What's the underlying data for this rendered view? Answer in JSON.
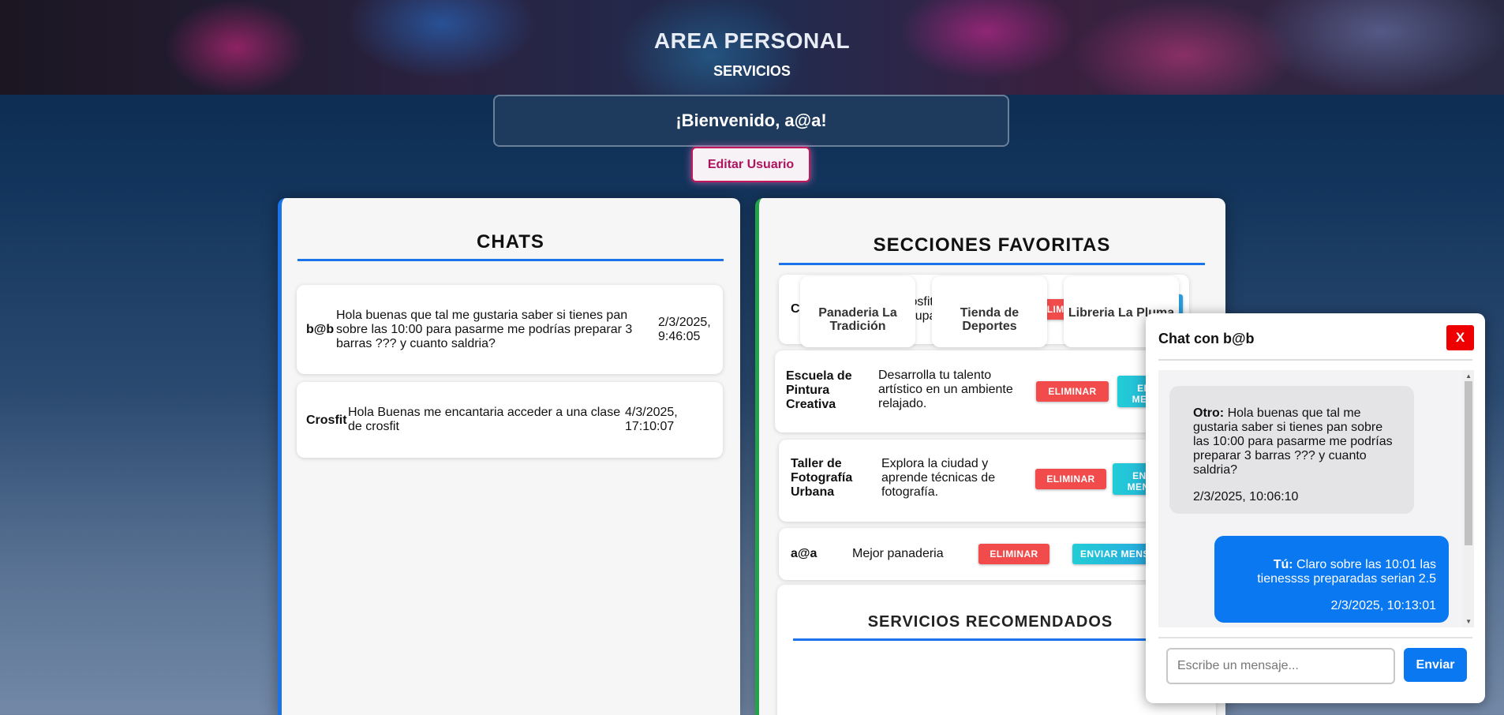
{
  "header": {
    "title": "AREA PERSONAL",
    "subtitle": "SERVICIOS"
  },
  "welcome": "¡Bienvenido, a@a!",
  "edit_user_label": "Editar Usuario",
  "chats": {
    "title": "CHATS",
    "items": [
      {
        "name": "b@b",
        "message": "Hola buenas que tal me gustaria saber si tienes pan sobre las 10:00 para pasarme me podrías preparar 3 barras ??? y cuanto saldria?",
        "date": "2/3/2025, 9:46:05"
      },
      {
        "name": "Crosfit",
        "message": "Hola Buenas me encantaria acceder a una clase de crosfit",
        "date": "4/3/2025, 17:10:07"
      }
    ]
  },
  "favorites": {
    "title": "SECCIONES FAVORITAS",
    "delete_label": "ELIMINAR",
    "message_label": "ENVIAR MENSAJE",
    "items": [
      {
        "name": "Crosfit",
        "description": "Clases de Crosfit de forma individual o grupal."
      },
      {
        "name": "Escuela de Pintura Creativa",
        "description": "Desarrolla tu talento artístico en un ambiente relajado."
      },
      {
        "name": "Taller de Fotografía Urbana",
        "description": "Explora la ciudad y aprende técnicas de fotografía."
      },
      {
        "name": "a@a",
        "description": "Mejor panaderia"
      }
    ]
  },
  "recommended": {
    "title": "SERVICIOS RECOMENDADOS",
    "items": [
      "Panaderia La Tradición",
      "Tienda de Deportes",
      "Libreria La Pluma"
    ]
  },
  "chat_window": {
    "title": "Chat con b@b",
    "close_label": "X",
    "messages": [
      {
        "sender": "Otro:",
        "text": "Hola buenas que tal me gustaria saber si tienes pan sobre las 10:00 para pasarme me podrías preparar 3 barras ??? y cuanto saldria?",
        "date": "2/3/2025, 10:06:10"
      },
      {
        "sender": "Tú:",
        "text": "Claro sobre las 10:01 las tienessss preparadas serian 2.5",
        "date": "2/3/2025, 10:13:01"
      }
    ],
    "input_placeholder": "Escribe un mensaje...",
    "send_label": "Enviar"
  },
  "colors": {
    "accent_blue": "#1a73e8",
    "delete_red": "#f24b4b",
    "message_cyan": "#22cdd6",
    "fav_green": "#22a34a",
    "edit_pink": "#c2185b"
  }
}
